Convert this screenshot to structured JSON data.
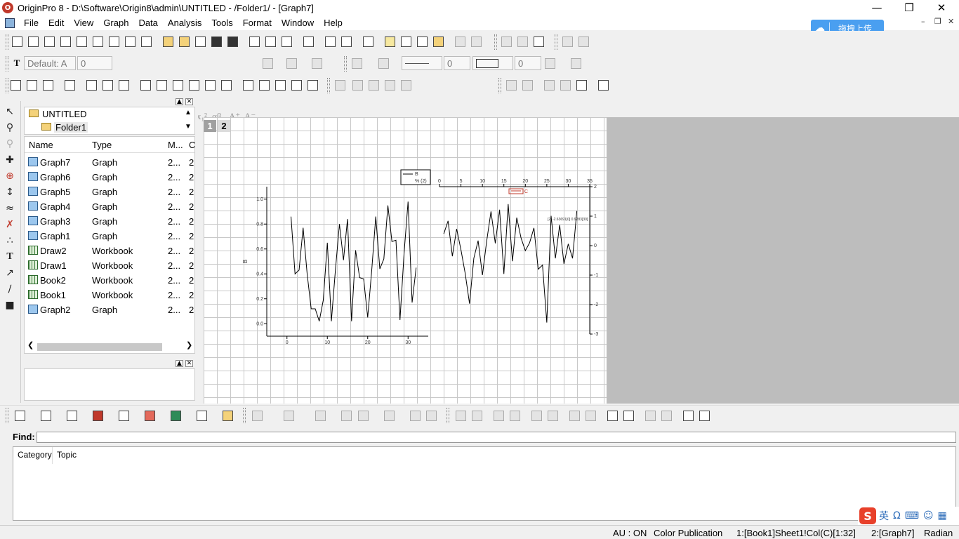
{
  "window": {
    "title": "OriginPro 8 - D:\\Software\\Origin8\\admin\\UNTITLED - /Folder1/ - [Graph7]",
    "app_icon_letter": "O",
    "minimize": "—",
    "restore": "❐",
    "close": "✕"
  },
  "menu": [
    "File",
    "Edit",
    "View",
    "Graph",
    "Data",
    "Analysis",
    "Tools",
    "Format",
    "Window",
    "Help"
  ],
  "mdi_controls": {
    "minimize": "–",
    "restore": "❐",
    "close": "✕"
  },
  "upload_button": {
    "label": "拖拽上传",
    "icon": "cloud-icon"
  },
  "format_toolbar": {
    "font_name": "Default: A",
    "font_size": "0",
    "line_width": "0",
    "border_width": "0"
  },
  "project_explorer": {
    "tree": [
      {
        "label": "UNTITLED",
        "icon": "folder-icon"
      },
      {
        "label": "Folder1",
        "icon": "folder-open-icon"
      }
    ],
    "columns": [
      "Name",
      "Type",
      "M...",
      "C"
    ],
    "rows": [
      {
        "name": "Graph7",
        "type": "Graph",
        "m": "2...",
        "c": "2",
        "icon": "graph-icon"
      },
      {
        "name": "Graph6",
        "type": "Graph",
        "m": "2...",
        "c": "2",
        "icon": "graph-icon"
      },
      {
        "name": "Graph5",
        "type": "Graph",
        "m": "2...",
        "c": "2",
        "icon": "graph-icon"
      },
      {
        "name": "Graph4",
        "type": "Graph",
        "m": "2...",
        "c": "2",
        "icon": "graph-icon"
      },
      {
        "name": "Graph3",
        "type": "Graph",
        "m": "2...",
        "c": "2",
        "icon": "graph-icon"
      },
      {
        "name": "Graph1",
        "type": "Graph",
        "m": "2...",
        "c": "2",
        "icon": "graph-icon"
      },
      {
        "name": "Draw2",
        "type": "Workbook",
        "m": "2...",
        "c": "2",
        "icon": "workbook-icon"
      },
      {
        "name": "Draw1",
        "type": "Workbook",
        "m": "2...",
        "c": "2",
        "icon": "workbook-icon"
      },
      {
        "name": "Book2",
        "type": "Workbook",
        "m": "2...",
        "c": "2",
        "icon": "workbook-icon"
      },
      {
        "name": "Book1",
        "type": "Workbook",
        "m": "2...",
        "c": "2",
        "icon": "workbook-icon"
      },
      {
        "name": "Graph2",
        "type": "Graph",
        "m": "2...",
        "c": "2",
        "icon": "graph-icon"
      }
    ]
  },
  "graph": {
    "layer_tabs": [
      "1",
      "2"
    ],
    "legend": {
      "line1": "B",
      "line2": "%  (2)"
    },
    "layer2_legend": "C",
    "annotation": "[2] -2.63691[0] 0.9283[30]",
    "chart_data": [
      {
        "type": "line",
        "title": "",
        "xlabel": "",
        "ylabel": "B",
        "xlim": [
          -5,
          35
        ],
        "ylim": [
          -0.1,
          1.1
        ],
        "xticks": [
          "0",
          "10",
          "20",
          "30"
        ],
        "yticks": [
          "0.0",
          "0.2",
          "0.4",
          "0.6",
          "0.8",
          "1.0"
        ],
        "grid": false,
        "series": [
          {
            "name": "B",
            "x": [
              1,
              2,
              3,
              4,
              5,
              6,
              7,
              8,
              9,
              10,
              11,
              12,
              13,
              14,
              15,
              16,
              17,
              18,
              19,
              20,
              21,
              22,
              23,
              24,
              25,
              26,
              27,
              28,
              29,
              30,
              31,
              32
            ],
            "y": [
              0.86,
              0.4,
              0.43,
              0.77,
              0.4,
              0.12,
              0.12,
              0.02,
              0.19,
              0.65,
              0.02,
              0.43,
              0.8,
              0.51,
              0.84,
              0.02,
              0.59,
              0.37,
              0.36,
              0.05,
              0.43,
              0.86,
              0.44,
              0.52,
              0.95,
              0.66,
              0.67,
              0.03,
              0.56,
              0.98,
              0.17,
              0.45
            ]
          }
        ]
      },
      {
        "type": "line",
        "title": "",
        "xlabel": "",
        "ylabel": "",
        "xlim": [
          0,
          35
        ],
        "ylim": [
          -3,
          2
        ],
        "xticks": [
          "0",
          "5",
          "10",
          "15",
          "20",
          "25",
          "30",
          "35"
        ],
        "yticks": [
          "-3",
          "-2",
          "-1",
          "0",
          "1",
          "2"
        ],
        "grid": false,
        "series": [
          {
            "name": "C",
            "x": [
              1,
              2,
              3,
              4,
              5,
              6,
              7,
              8,
              9,
              10,
              11,
              12,
              13,
              14,
              15,
              16,
              17,
              18,
              19,
              20,
              21,
              22,
              23,
              24,
              25,
              26,
              27,
              28,
              29,
              30,
              31,
              32
            ],
            "y": [
              0.4,
              0.84,
              -0.36,
              0.57,
              -0.14,
              -0.95,
              -1.97,
              -0.43,
              0.17,
              -1.0,
              0.16,
              1.16,
              0.08,
              1.22,
              -0.96,
              1.41,
              -0.53,
              0.95,
              0.26,
              -0.17,
              0.1,
              0.6,
              -0.8,
              -0.66,
              -2.61,
              1.01,
              -0.43,
              0.7,
              -0.62,
              0.06,
              -0.43,
              1.18
            ]
          }
        ]
      }
    ]
  },
  "find_label": "Find:",
  "help_tabs": [
    "Category",
    "Topic"
  ],
  "status": {
    "autoupdate": "AU : ON",
    "theme": "Color Publication",
    "active_col": "1:[Book1]Sheet1!Col(C)[1:32]",
    "active_graph": "2:[Graph7]",
    "angle_unit": "Radian"
  },
  "ime": {
    "logo": "S",
    "lang": "英"
  }
}
